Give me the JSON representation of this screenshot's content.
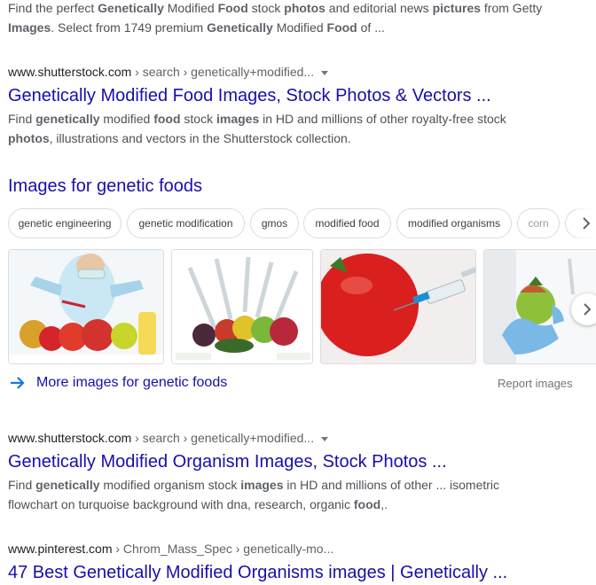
{
  "result0": {
    "snippet_line1": [
      {
        "t": "Find the perfect ",
        "b": false
      },
      {
        "t": "Genetically",
        "b": true
      },
      {
        "t": " Modified ",
        "b": false
      },
      {
        "t": "Food",
        "b": true
      },
      {
        "t": " stock ",
        "b": false
      },
      {
        "t": "photos",
        "b": true
      },
      {
        "t": " and editorial news ",
        "b": false
      },
      {
        "t": "pictures",
        "b": true
      },
      {
        "t": " from Getty",
        "b": false
      }
    ],
    "snippet_line2": [
      {
        "t": "Images",
        "b": true
      },
      {
        "t": ". Select from 1749 premium ",
        "b": false
      },
      {
        "t": "Genetically",
        "b": true
      },
      {
        "t": " Modified ",
        "b": false
      },
      {
        "t": "Food",
        "b": true
      },
      {
        "t": " of ...",
        "b": false
      }
    ]
  },
  "result1": {
    "domain": "www.shutterstock.com",
    "breadcrumb": " › search › genetically+modified...",
    "title": "Genetically Modified Food Images, Stock Photos & Vectors ...",
    "snippet_line1": [
      {
        "t": "Find ",
        "b": false
      },
      {
        "t": "genetically",
        "b": true
      },
      {
        "t": " modified ",
        "b": false
      },
      {
        "t": "food",
        "b": true
      },
      {
        "t": " stock ",
        "b": false
      },
      {
        "t": "images",
        "b": true
      },
      {
        "t": " in HD and millions of other royalty-free stock",
        "b": false
      }
    ],
    "snippet_line2": [
      {
        "t": "photos",
        "b": true
      },
      {
        "t": ", illustrations and vectors in the Shutterstock collection.",
        "b": false
      }
    ]
  },
  "images_section": {
    "heading": "Images for genetic foods",
    "chips": [
      "genetic engineering",
      "genetic modification",
      "gmos",
      "modified food",
      "modified organisms",
      "corn"
    ],
    "thumbs": [
      {
        "name": "thumb-scientist-fruits",
        "alt": "scientist injecting fruits"
      },
      {
        "name": "thumb-syringes-fruits",
        "alt": "syringes in fruits"
      },
      {
        "name": "thumb-tomato-syringe",
        "alt": "tomato with syringe"
      },
      {
        "name": "thumb-gloved-hand-tomato",
        "alt": "gloved hand holding tomato"
      }
    ],
    "more_link": "More images for genetic foods",
    "report": "Report images"
  },
  "result2": {
    "domain": "www.shutterstock.com",
    "breadcrumb": " › search › genetically+modified...",
    "title": "Genetically Modified Organism Images, Stock Photos ...",
    "snippet_line1": [
      {
        "t": "Find ",
        "b": false
      },
      {
        "t": "genetically",
        "b": true
      },
      {
        "t": " modified organism stock ",
        "b": false
      },
      {
        "t": "images",
        "b": true
      },
      {
        "t": " in HD and millions of other ... isometric",
        "b": false
      }
    ],
    "snippet_line2": [
      {
        "t": "flowchart on turquoise background with dna, research, organic ",
        "b": false
      },
      {
        "t": "food",
        "b": true
      },
      {
        "t": ",.",
        "b": false
      }
    ]
  },
  "result3": {
    "domain": "www.pinterest.com",
    "breadcrumb": " › Chrom_Mass_Spec › genetically-mo...",
    "title": "47 Best Genetically Modified Organisms images | Genetically ..."
  },
  "icons": {
    "chip_scroll": "chevron-right-icon",
    "carousel_next": "chevron-right-icon",
    "more_arrow": "arrow-right-icon",
    "menu_caret": "caret-down-icon"
  },
  "colors": {
    "link": "#1a0dab",
    "text": "#4d5156",
    "url": "#202124",
    "border": "#dadce0"
  }
}
